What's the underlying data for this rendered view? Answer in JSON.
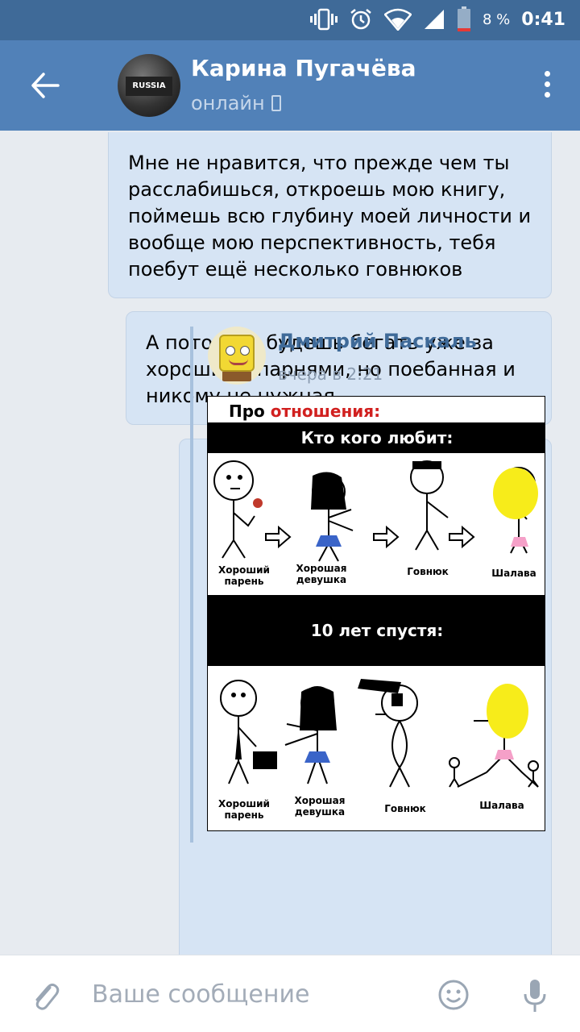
{
  "status_bar": {
    "battery_percent": "8 %",
    "time": "0:41",
    "icons": [
      "vibrate-icon",
      "alarm-icon",
      "wifi-icon",
      "signal-icon",
      "battery-icon"
    ]
  },
  "header": {
    "contact_name": "Карина Пугачёва",
    "status": "онлайн",
    "avatar_cap_text": "RUSSIA"
  },
  "messages": [
    {
      "text": "Мне не нравится, что прежде чем ты расслабишься, откроешь мою книгу, поймешь всю глубину моей личности и вообще мою перспективность, тебя поебут ещё несколько говнюков"
    },
    {
      "text": "А потом ты будешь бегать уже за хорошими парнями, но поебанная и никому не нужная"
    }
  ],
  "forwarded": {
    "author": "Дмитрий Паскаль",
    "time": "вчера в 2:21",
    "image": {
      "title_prefix": "Про ",
      "title_highlight": "отношения:",
      "band1": "Кто кого любит:",
      "band2": "10 лет спустя:",
      "labels_top": [
        "Хороший парень",
        "Хорошая девушка",
        "Говнюк",
        "Шалава"
      ],
      "labels_bottom": [
        "Хороший парень",
        "Хорошая девушка",
        "Говнюк",
        "Шалава"
      ]
    }
  },
  "composer": {
    "placeholder": "Ваше сообщение"
  },
  "colors": {
    "status_bar": "#3f6a98",
    "header": "#5181b8",
    "bubble": "#d6e4f4",
    "chat_bg": "#e7ebf0",
    "link": "#3f6a98"
  }
}
